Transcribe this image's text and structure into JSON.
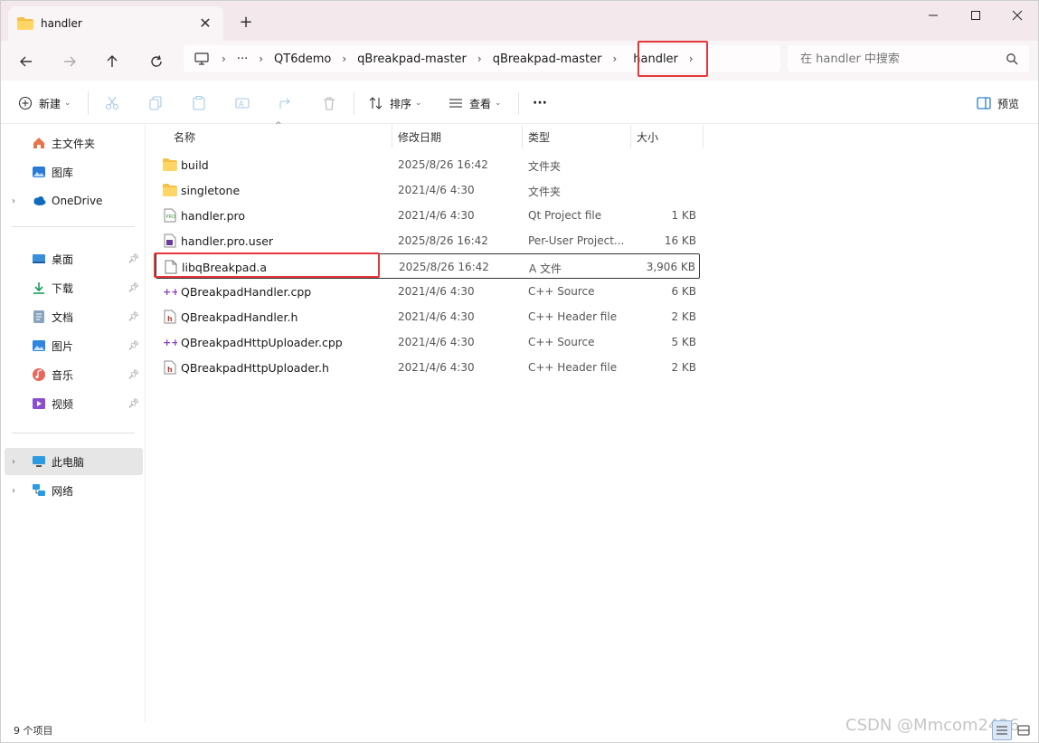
{
  "tab": {
    "title": "handler",
    "close": "✕",
    "new_tab": "+"
  },
  "window_controls": {
    "minimize": "—",
    "maximize": "☐",
    "close": "✕"
  },
  "breadcrumb": {
    "ellipsis": "···",
    "items": [
      "QT6demo",
      "qBreakpad-master",
      "qBreakpad-master",
      "handler"
    ]
  },
  "search": {
    "placeholder": "在 handler 中搜索"
  },
  "toolbar": {
    "new_label": "新建",
    "sort_label": "排序",
    "view_label": "查看",
    "more_label": "···",
    "preview_label": "预览"
  },
  "sidebar": {
    "items": [
      {
        "label": "主文件夹",
        "icon": "home-icon"
      },
      {
        "label": "图库",
        "icon": "gallery-icon"
      },
      {
        "label": "OneDrive",
        "icon": "onedrive-icon"
      },
      {
        "label": "桌面",
        "icon": "desktop-icon"
      },
      {
        "label": "下载",
        "icon": "download-icon"
      },
      {
        "label": "文档",
        "icon": "documents-icon"
      },
      {
        "label": "图片",
        "icon": "pictures-icon"
      },
      {
        "label": "音乐",
        "icon": "music-icon"
      },
      {
        "label": "视频",
        "icon": "videos-icon"
      },
      {
        "label": "此电脑",
        "icon": "computer-icon"
      },
      {
        "label": "网络",
        "icon": "network-icon"
      }
    ]
  },
  "columns": {
    "name": "名称",
    "date": "修改日期",
    "type": "类型",
    "size": "大小"
  },
  "files": [
    {
      "name": "build",
      "date": "2025/8/26 16:42",
      "type": "文件夹",
      "size": "",
      "icon": "folder-icon"
    },
    {
      "name": "singletone",
      "date": "2021/4/6 4:30",
      "type": "文件夹",
      "size": "",
      "icon": "folder-icon"
    },
    {
      "name": "handler.pro",
      "date": "2021/4/6 4:30",
      "type": "Qt Project file",
      "size": "1 KB",
      "icon": "pro-file-icon"
    },
    {
      "name": "handler.pro.user",
      "date": "2025/8/26 16:42",
      "type": "Per-User Project...",
      "size": "16 KB",
      "icon": "user-file-icon"
    },
    {
      "name": "libqBreakpad.a",
      "date": "2025/8/26 16:42",
      "type": "A 文件",
      "size": "3,906 KB",
      "icon": "blank-file-icon"
    },
    {
      "name": "QBreakpadHandler.cpp",
      "date": "2021/4/6 4:30",
      "type": "C++ Source",
      "size": "6 KB",
      "icon": "cpp-file-icon"
    },
    {
      "name": "QBreakpadHandler.h",
      "date": "2021/4/6 4:30",
      "type": "C++ Header file",
      "size": "2 KB",
      "icon": "h-file-icon"
    },
    {
      "name": "QBreakpadHttpUploader.cpp",
      "date": "2021/4/6 4:30",
      "type": "C++ Source",
      "size": "5 KB",
      "icon": "cpp-file-icon"
    },
    {
      "name": "QBreakpadHttpUploader.h",
      "date": "2021/4/6 4:30",
      "type": "C++ Header file",
      "size": "2 KB",
      "icon": "h-file-icon"
    }
  ],
  "status": {
    "count": "9 个项目"
  },
  "watermark": "CSDN @Mmcom2426",
  "colors": {
    "highlight": "#e5373b",
    "folder": "#f4c04a",
    "accent": "#0067c0"
  }
}
